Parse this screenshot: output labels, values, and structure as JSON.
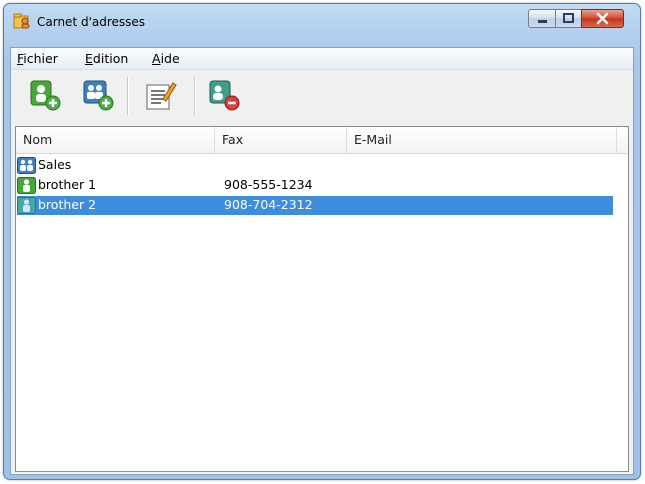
{
  "window": {
    "title": "Carnet d'adresses"
  },
  "menu": {
    "items": [
      {
        "prefix": "",
        "access_key": "F",
        "rest": "ichier"
      },
      {
        "prefix": "",
        "access_key": "E",
        "rest": "dition"
      },
      {
        "prefix": "",
        "access_key": "A",
        "rest": "ide"
      }
    ]
  },
  "toolbar": {
    "icons": [
      "add-contact-icon",
      "add-group-icon",
      "edit-icon",
      "delete-contact-icon"
    ]
  },
  "list": {
    "columns": [
      "Nom",
      "Fax",
      "E-Mail"
    ],
    "rows": [
      {
        "type": "group",
        "name": "Sales",
        "fax": "",
        "email": ""
      },
      {
        "type": "contact",
        "name": "brother 1",
        "fax": "908-555-1234",
        "email": ""
      },
      {
        "type": "contact",
        "name": "brother 2",
        "fax": "908-704-2312",
        "email": "",
        "selected": true
      }
    ]
  },
  "colors": {
    "selection": "#3e8ddd",
    "title_gradient": "#b3cfee",
    "close_button": "#c2351b"
  }
}
